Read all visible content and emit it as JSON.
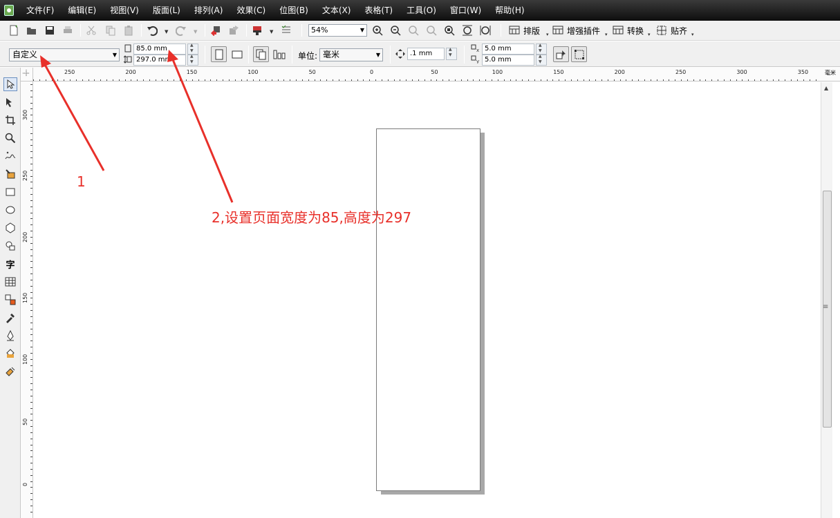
{
  "menubar": {
    "items": [
      "文件(F)",
      "编辑(E)",
      "视图(V)",
      "版面(L)",
      "排列(A)",
      "效果(C)",
      "位图(B)",
      "文本(X)",
      "表格(T)",
      "工具(O)",
      "窗口(W)",
      "帮助(H)"
    ]
  },
  "toolbar": {
    "zoom_value": "54%",
    "plugin_buttons": [
      "排版",
      "增强插件",
      "转换",
      "贴齐"
    ]
  },
  "propertybar": {
    "page_preset": "自定义",
    "page_width": "85.0 mm",
    "page_height": "297.0 mm",
    "units_label": "单位:",
    "units_value": "毫米",
    "nudge_value": ".1 mm",
    "duplicate_x": "5.0 mm",
    "duplicate_y": "5.0 mm"
  },
  "ruler": {
    "unit": "毫米",
    "horizontal_labels": [
      "250",
      "200",
      "150",
      "100",
      "50",
      "0",
      "50",
      "100",
      "150",
      "200",
      "250",
      "300",
      "350"
    ],
    "vertical_labels": [
      "300",
      "250",
      "200",
      "150",
      "100",
      "50",
      "0"
    ]
  },
  "annotations": {
    "step1": "1",
    "step2": "2,设置页面宽度为85,高度为297"
  },
  "colors": {
    "annotation": "#e8302a",
    "menubar_bg": "#1a1a1a",
    "toolbar_bg": "#f0f0f0"
  }
}
